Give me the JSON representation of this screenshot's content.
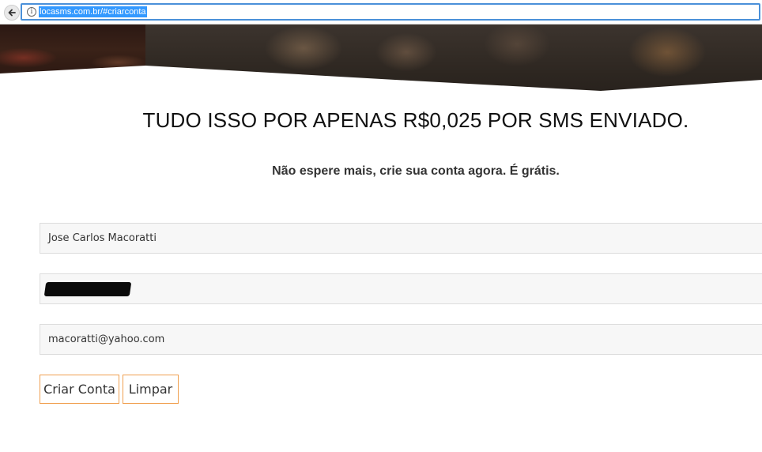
{
  "browser": {
    "url": "locasms.com.br/#criarconta",
    "info_glyph": "i"
  },
  "hero": {
    "headline": "TUDO ISSO POR APENAS R$0,025 POR SMS ENVIADO.",
    "subheadline": "Não espere mais, crie sua conta agora. É grátis."
  },
  "form": {
    "name_value": "Jose Carlos Macoratti",
    "phone_value": "",
    "email_value": "macoratti@yahoo.com",
    "create_button_label": "Criar Conta",
    "clear_button_label": "Limpar"
  },
  "colors": {
    "button_border": "#f0a050",
    "field_background": "#f7f7f7",
    "url_selection": "#3399ff"
  }
}
